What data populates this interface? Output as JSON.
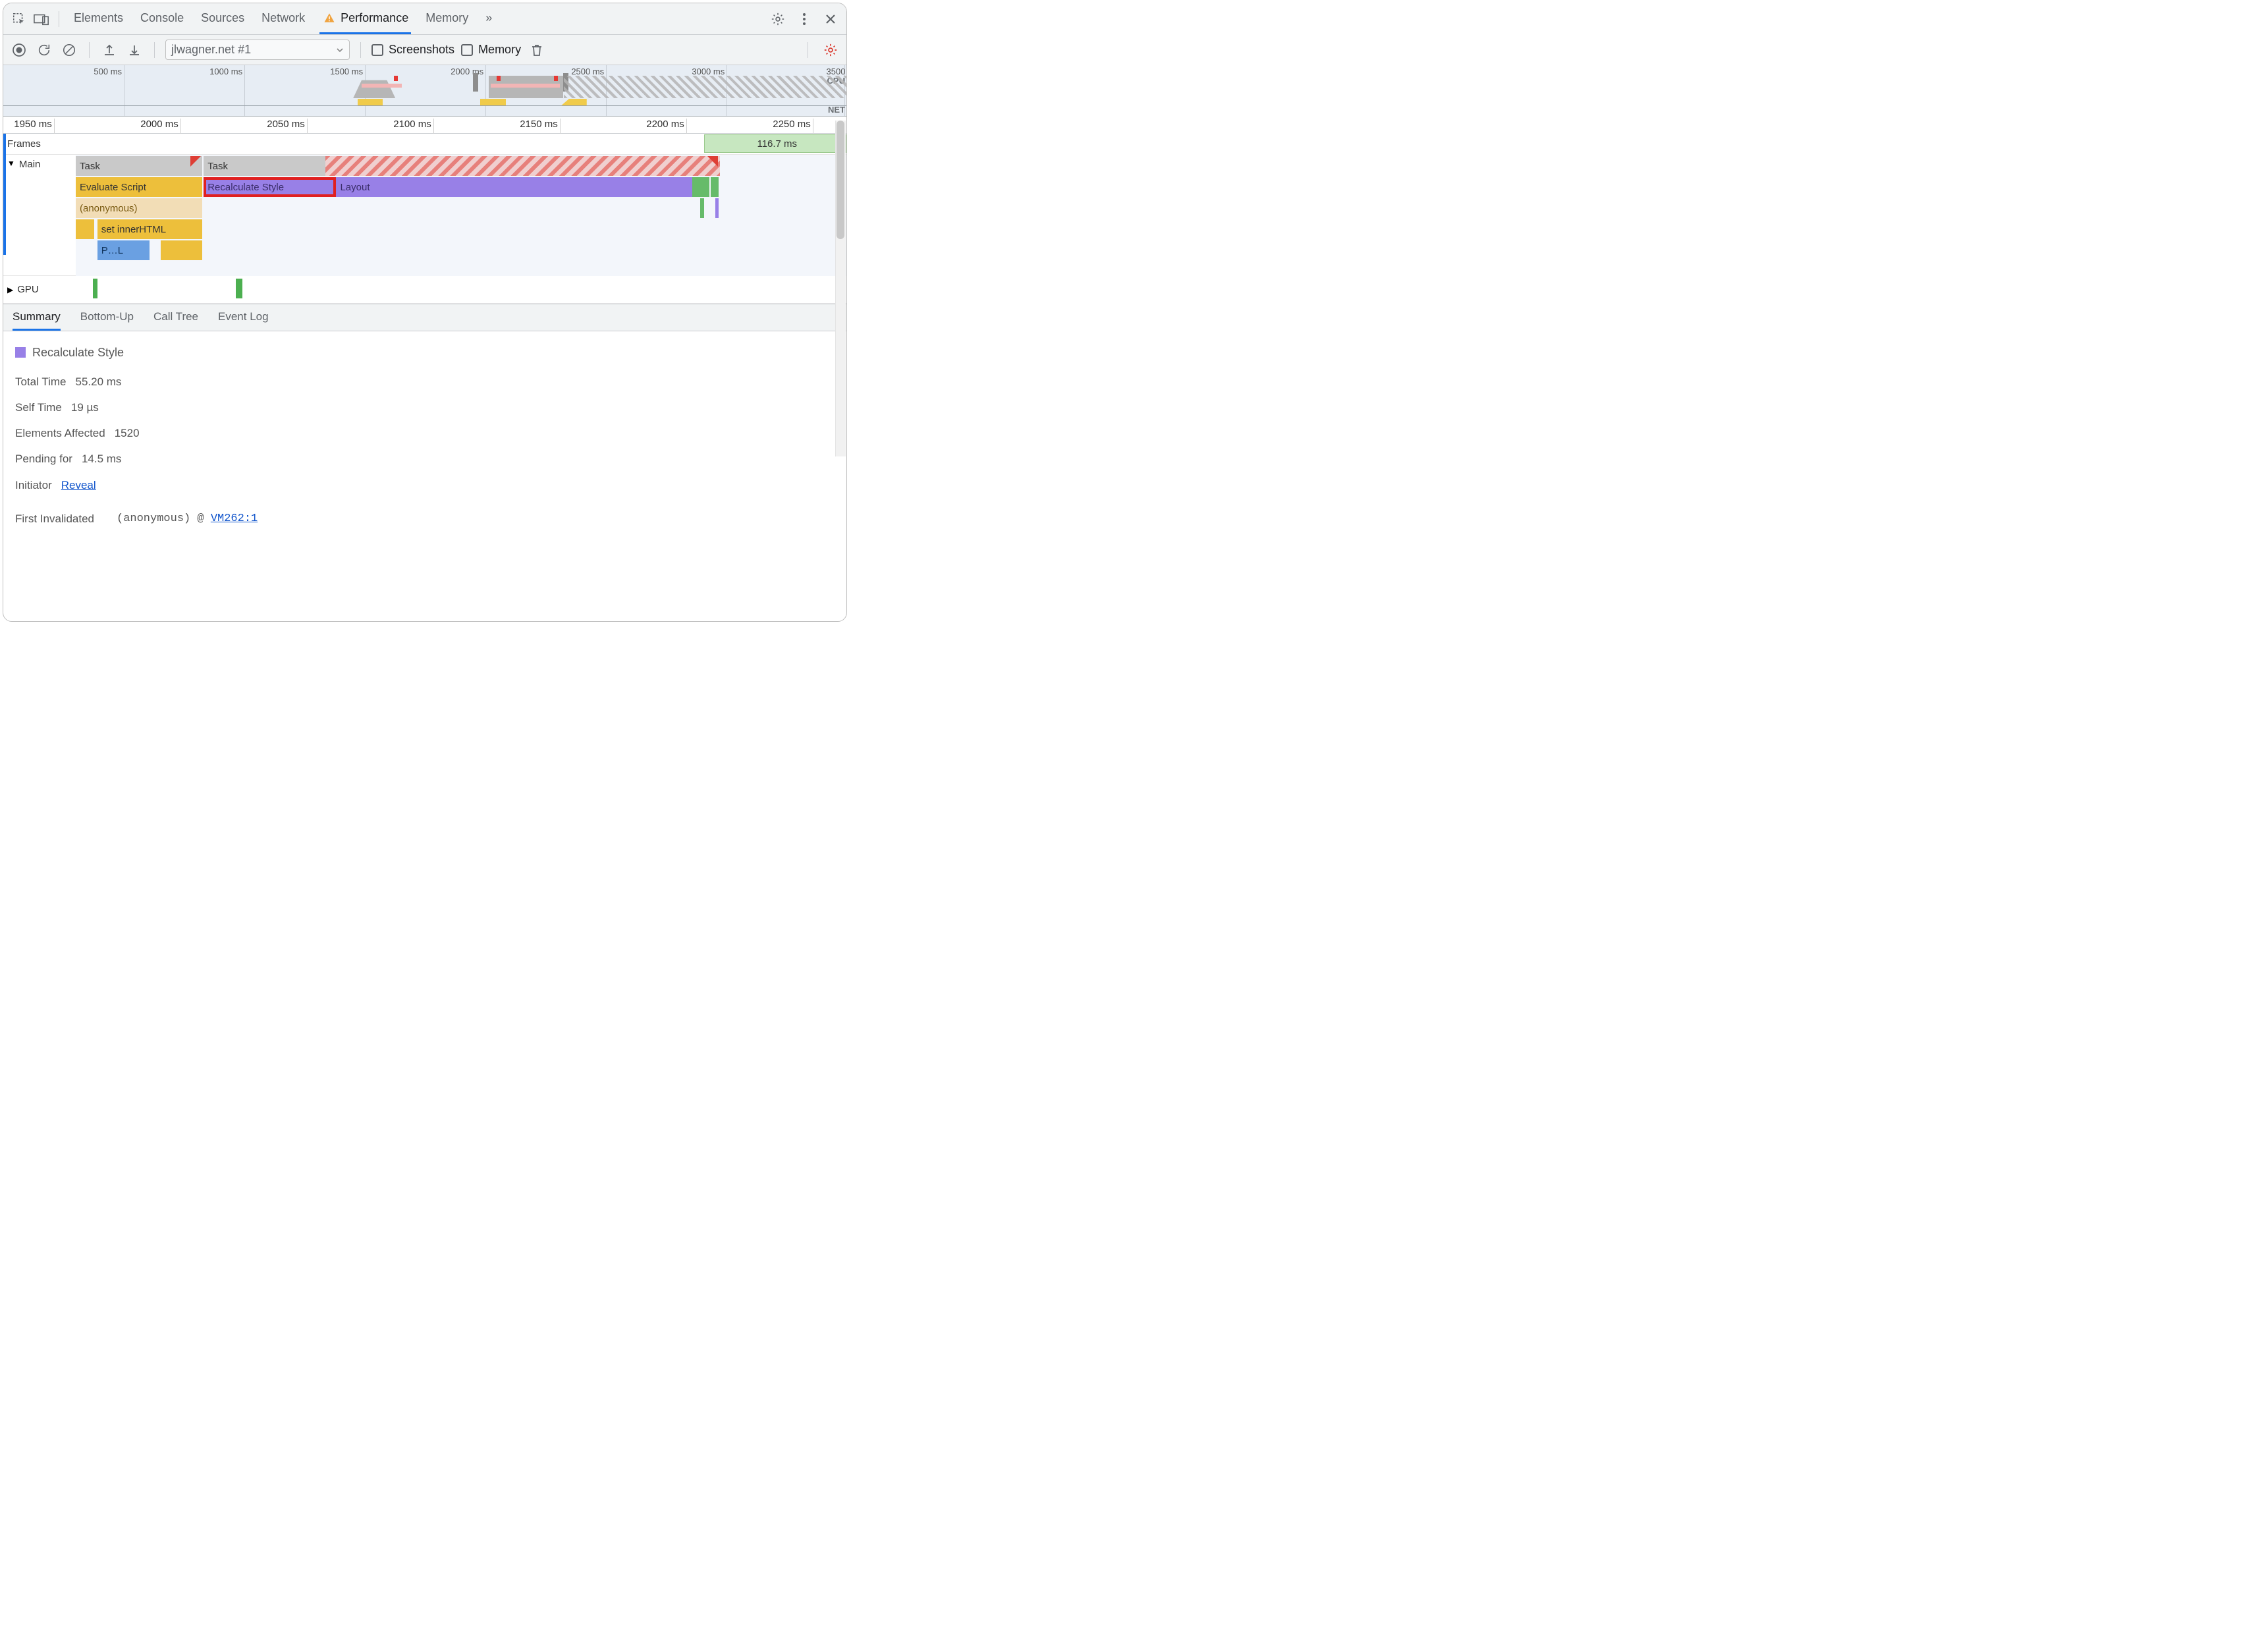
{
  "tabs": {
    "elements": "Elements",
    "console": "Console",
    "sources": "Sources",
    "network": "Network",
    "performance": "Performance",
    "memory": "Memory",
    "more": "»"
  },
  "toolbar": {
    "profile_name": "jlwagner.net #1",
    "screenshots": "Screenshots",
    "memory": "Memory"
  },
  "overview": {
    "ticks": [
      "500 ms",
      "1000 ms",
      "1500 ms",
      "2000 ms",
      "2500 ms",
      "3000 ms",
      "3500"
    ],
    "cpu": "CPU",
    "net": "NET"
  },
  "ruler": [
    "1950 ms",
    "2000 ms",
    "2050 ms",
    "2100 ms",
    "2150 ms",
    "2200 ms",
    "2250 ms"
  ],
  "tracks": {
    "frames": "Frames",
    "frames_value": "116.7 ms",
    "main": "Main",
    "gpu": "GPU",
    "row_task": "Task",
    "row_task2": "Task",
    "row_eval": "Evaluate Script",
    "row_recalc": "Recalculate Style",
    "row_layout": "Layout",
    "row_anon": "(anonymous)",
    "row_set": "set innerHTML",
    "row_pl": "P…L"
  },
  "btabs": {
    "summary": "Summary",
    "bottom_up": "Bottom-Up",
    "call_tree": "Call Tree",
    "event_log": "Event Log"
  },
  "summary": {
    "title": "Recalculate Style",
    "total_time_k": "Total Time",
    "total_time_v": "55.20 ms",
    "self_time_k": "Self Time",
    "self_time_v": "19 µs",
    "elements_k": "Elements Affected",
    "elements_v": "1520",
    "pending_k": "Pending for",
    "pending_v": "14.5 ms",
    "initiator_k": "Initiator",
    "initiator_v": "Reveal",
    "first_inv": "First Invalidated",
    "stack_fn": "(anonymous)",
    "stack_at": "@",
    "stack_src": "VM262:1"
  }
}
